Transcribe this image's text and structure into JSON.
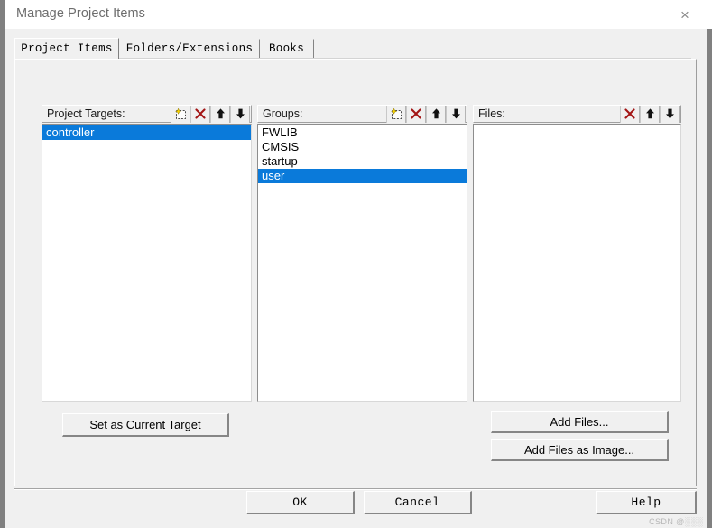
{
  "window": {
    "title": "Manage Project Items",
    "close_icon": "close-icon",
    "close_glyph": "×"
  },
  "tabs": [
    {
      "label": "Project Items",
      "active": true
    },
    {
      "label": "Folders/Extensions",
      "active": false
    },
    {
      "label": "Books",
      "active": false
    }
  ],
  "columns": {
    "project_targets": {
      "label": "Project Targets:",
      "tools": [
        "new-item-icon",
        "delete-icon",
        "move-up-icon",
        "move-down-icon"
      ],
      "items": [
        {
          "label": "controller",
          "selected": true
        }
      ]
    },
    "groups": {
      "label": "Groups:",
      "tools": [
        "new-item-icon",
        "delete-icon",
        "move-up-icon",
        "move-down-icon"
      ],
      "items": [
        {
          "label": "FWLIB",
          "selected": false
        },
        {
          "label": "CMSIS",
          "selected": false
        },
        {
          "label": "startup",
          "selected": false
        },
        {
          "label": "user",
          "selected": true
        }
      ]
    },
    "files": {
      "label": "Files:",
      "tools": [
        "delete-icon",
        "move-up-icon",
        "move-down-icon"
      ],
      "items": []
    }
  },
  "buttons": {
    "set_as_current_target": "Set as Current Target",
    "add_files": "Add Files...",
    "add_files_as_image": "Add Files as Image...",
    "ok": "OK",
    "cancel": "Cancel",
    "help": "Help"
  },
  "watermark": "CSDN @░░░",
  "colors": {
    "selection_blue": "#0a7ada",
    "dialog_face": "#f0f0f0",
    "window_border": "#808080",
    "delete_red": "#a31515",
    "title_text": "#6d6d6d"
  }
}
